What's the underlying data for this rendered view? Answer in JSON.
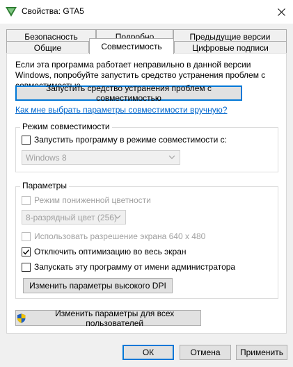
{
  "window": {
    "title": "Свойства: GTA5",
    "app_icon": "gta-v-icon",
    "close_icon": "close-icon"
  },
  "tabs": {
    "row1": [
      "Безопасность",
      "Подробно",
      "Предыдущие версии"
    ],
    "row2": [
      "Общие",
      "Совместимость",
      "Цифровые подписи"
    ],
    "active": "Совместимость"
  },
  "intro": {
    "text": "Если эта программа работает неправильно в данной версии Windows, попробуйте запустить средство устранения проблем с совместимостью."
  },
  "troubleshooter_button": "Запустить средство устранения проблем с совместимостью",
  "manual_link": "Как мне выбрать параметры совместимости вручную?",
  "compat_mode": {
    "label": "Режим совместимости",
    "checkbox_label": "Запустить программу в режиме совместимости с:",
    "checked": false,
    "os_value": "Windows 8"
  },
  "settings": {
    "label": "Параметры",
    "reduced_color": {
      "label": "Режим пониженной цветности",
      "checked": false,
      "enabled": false
    },
    "color_value": "8-разрядный цвет (256)",
    "resolution": {
      "label": "Использовать разрешение экрана 640 x 480",
      "checked": false,
      "enabled": false
    },
    "fullscreen_opt": {
      "label": "Отключить оптимизацию во весь экран",
      "checked": true,
      "enabled": true
    },
    "run_as_admin": {
      "label": "Запускать эту программу от имени администратора",
      "checked": false,
      "enabled": true
    },
    "dpi_button": "Изменить параметры высокого DPI"
  },
  "all_users_button": {
    "label": "Изменить параметры для всех пользователей",
    "icon": "uac-shield-icon"
  },
  "footer": {
    "ok": "ОК",
    "cancel": "Отмена",
    "apply": "Применить"
  },
  "colors": {
    "accent": "#0078d7",
    "link": "#0066cc",
    "check": "#000000"
  }
}
